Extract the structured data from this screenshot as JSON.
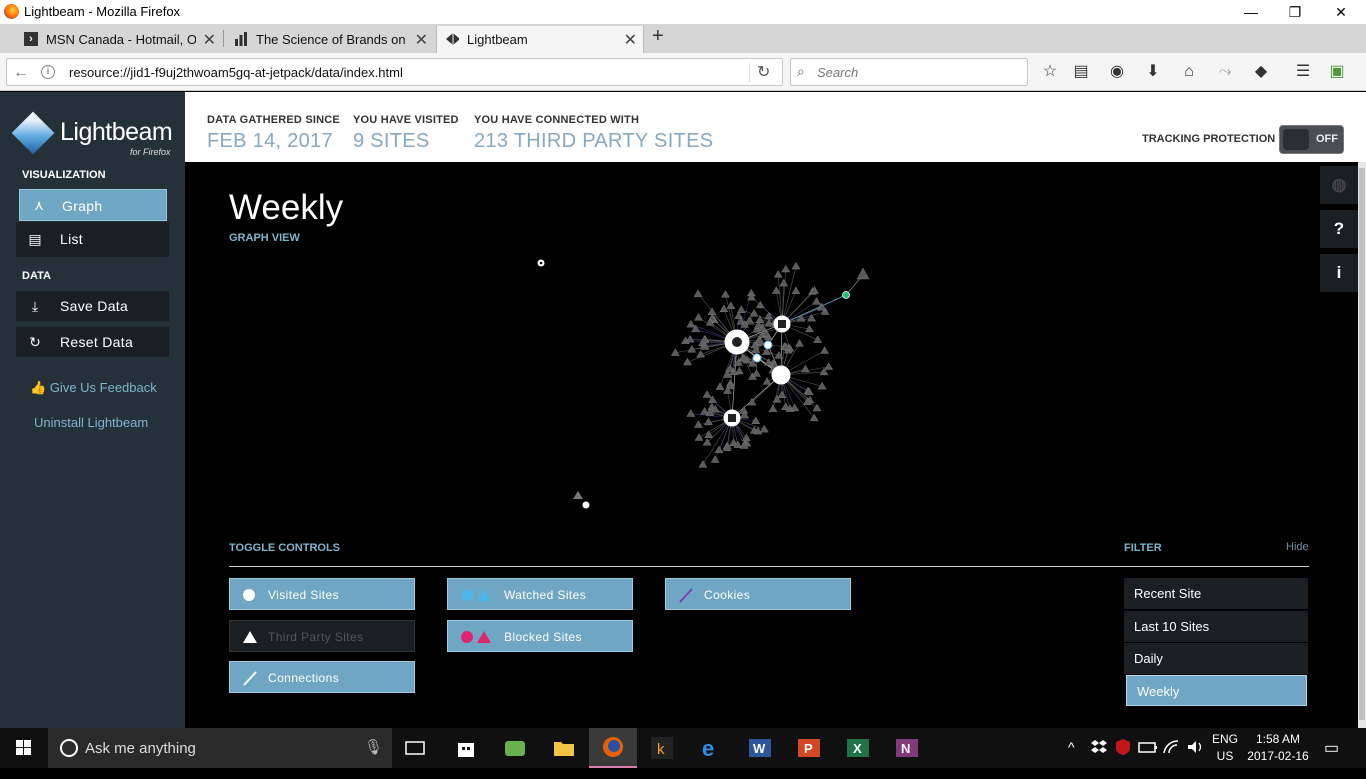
{
  "window": {
    "title": "Lightbeam - Mozilla Firefox",
    "minimize": "—",
    "restore": "❐",
    "close": "✕"
  },
  "tabs": [
    {
      "label": "MSN Canada - Hotmail, O...",
      "icon": "msn-icon"
    },
    {
      "label": "The Science of Brands on I...",
      "icon": "chart-icon"
    },
    {
      "label": "Lightbeam",
      "icon": "lightbeam-icon"
    }
  ],
  "new_tab": "+",
  "tab_close": "✕",
  "navbar": {
    "back": "←",
    "info": "i",
    "url": "resource://jid1-f9uj2thwoam5gq-at-jetpack/data/index.html",
    "reload": "↻",
    "search_placeholder": "Search",
    "search_glyph": "⌕",
    "icons": [
      "star-icon",
      "reading-list-icon",
      "pocket-icon",
      "download-icon",
      "home-icon",
      "share-icon",
      "lightbeam-toolbar-icon",
      "menu-icon",
      "extension-icon"
    ],
    "glyphs": [
      "☆",
      "▤",
      "◉",
      "⬇",
      "⌂",
      "⤳",
      "◆",
      "☰",
      "▣"
    ]
  },
  "sidebar": {
    "logo_text": "Lightbeam",
    "logo_sub": "for Firefox",
    "visualization_heading": "VISUALIZATION",
    "graph_label": "Graph",
    "list_label": "List",
    "data_heading": "DATA",
    "save_label": "Save Data",
    "reset_label": "Reset Data",
    "feedback_label": "Give Us Feedback",
    "uninstall_label": "Uninstall Lightbeam",
    "icon_glyphs": {
      "graph": "⋏",
      "list": "▤",
      "save": "⤓",
      "reset": "↻",
      "feedback": "👍"
    }
  },
  "header": {
    "since_label": "DATA GATHERED SINCE",
    "since_value": "FEB 14, 2017",
    "visited_label": "YOU HAVE VISITED",
    "visited_value": "9 SITES",
    "connected_label": "YOU HAVE CONNECTED WITH",
    "connected_value": "213 THIRD PARTY SITES",
    "tracking_label": "TRACKING PROTECTION",
    "tracking_state": "OFF"
  },
  "main": {
    "title": "Weekly",
    "subtitle": "GRAPH VIEW",
    "toggle_heading": "TOGGLE CONTROLS",
    "filter_heading": "FILTER",
    "hide_label": "Hide",
    "toggles": {
      "visited": "Visited Sites",
      "third_party": "Third Party Sites",
      "connections": "Connections",
      "watched": "Watched Sites",
      "blocked": "Blocked Sites",
      "cookies": "Cookies"
    },
    "filters": [
      "Recent Site",
      "Last 10 Sites",
      "Daily",
      "Weekly"
    ],
    "selected_filter": "Weekly"
  },
  "right_tools": {
    "globe": "◍",
    "help": "?",
    "info": "i"
  },
  "taskbar": {
    "search_text": "Ask me anything",
    "mic": "🎙",
    "apps": [
      "task-view-icon",
      "store-icon",
      "cloud-app-icon",
      "file-explorer-icon",
      "firefox-icon",
      "kindle-icon",
      "edge-icon",
      "word-icon",
      "powerpoint-icon",
      "excel-icon",
      "onenote-icon"
    ],
    "lang": "ENG",
    "region": "US",
    "time": "1:58 AM",
    "date": "2017-02-16",
    "chevron": "^",
    "notif": "▭"
  },
  "colors": {
    "accent": "#6fa6c3",
    "sidebar": "#253139",
    "stat_value": "#86a8c0",
    "link": "#7fb4cf",
    "blocked": "#e0246e",
    "watched": "#4db6e8"
  }
}
